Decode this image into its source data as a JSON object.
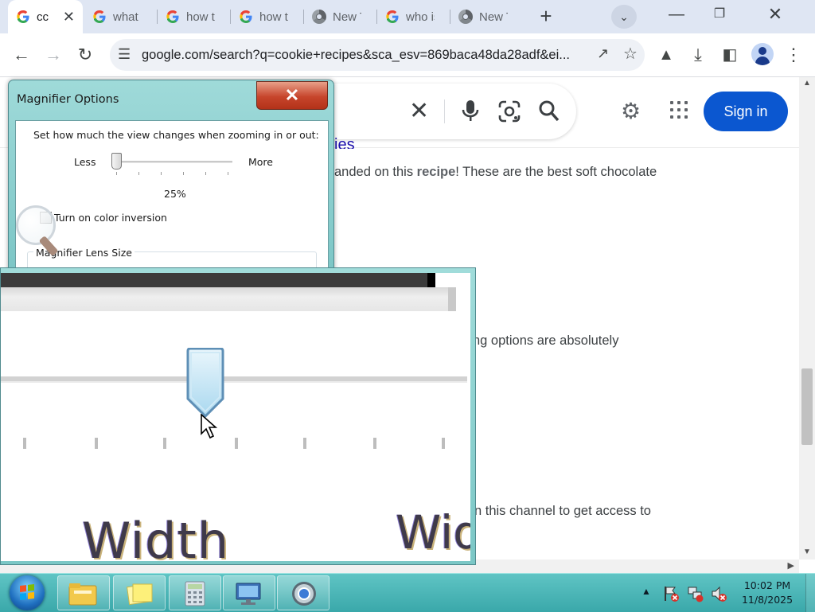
{
  "browser": {
    "tabs": [
      {
        "title": "cc",
        "icon": "google-g-icon",
        "active": true
      },
      {
        "title": "what a",
        "icon": "google-g-icon"
      },
      {
        "title": "how to",
        "icon": "google-g-icon"
      },
      {
        "title": "how to",
        "icon": "google-g-icon"
      },
      {
        "title": "New T",
        "icon": "chrome-icon"
      },
      {
        "title": "who is",
        "icon": "google-g-icon"
      },
      {
        "title": "New T",
        "icon": "chrome-icon"
      }
    ],
    "url": "google.com/search?q=cookie+recipes&sca_esv=869baca48da28adf&ei..."
  },
  "google": {
    "sign_in": "Sign in",
    "heading_fragment": "ies",
    "snippets": [
      {
        "pre": "anded on this ",
        "bold": "recipe",
        "post": "! These are the best soft chocolate"
      },
      {
        "pre": "ng options are absolutely",
        "bold": "",
        "post": ""
      },
      {
        "pre": "n this channel to get access to",
        "bold": "",
        "post": ""
      }
    ]
  },
  "magnifier_options": {
    "title": "Magnifier Options",
    "close_label": "✕",
    "description": "Set how much the view changes when zooming in or out:",
    "less_label": "Less",
    "more_label": "More",
    "zoom_increment": "25%",
    "zoom_increment_fraction": 0.0,
    "color_inversion_label": "Turn on color inversion",
    "color_inversion_checked": false,
    "lens_size_group": "Magnifier Lens Size"
  },
  "magnifier_lens": {
    "magnified_text_left": "Width",
    "magnified_text_right": "Wid"
  },
  "taskbar": {
    "pinned": [
      "windows-explorer-icon",
      "sticky-notes-icon",
      "calculator-icon",
      "remote-desktop-icon",
      "chrome-icon"
    ],
    "time": "10:02 PM",
    "date": "11/8/2025"
  },
  "colors": {
    "accent_blue": "#0b57d0",
    "aero_teal": "#7cc6c6",
    "close_red": "#c7452c"
  }
}
